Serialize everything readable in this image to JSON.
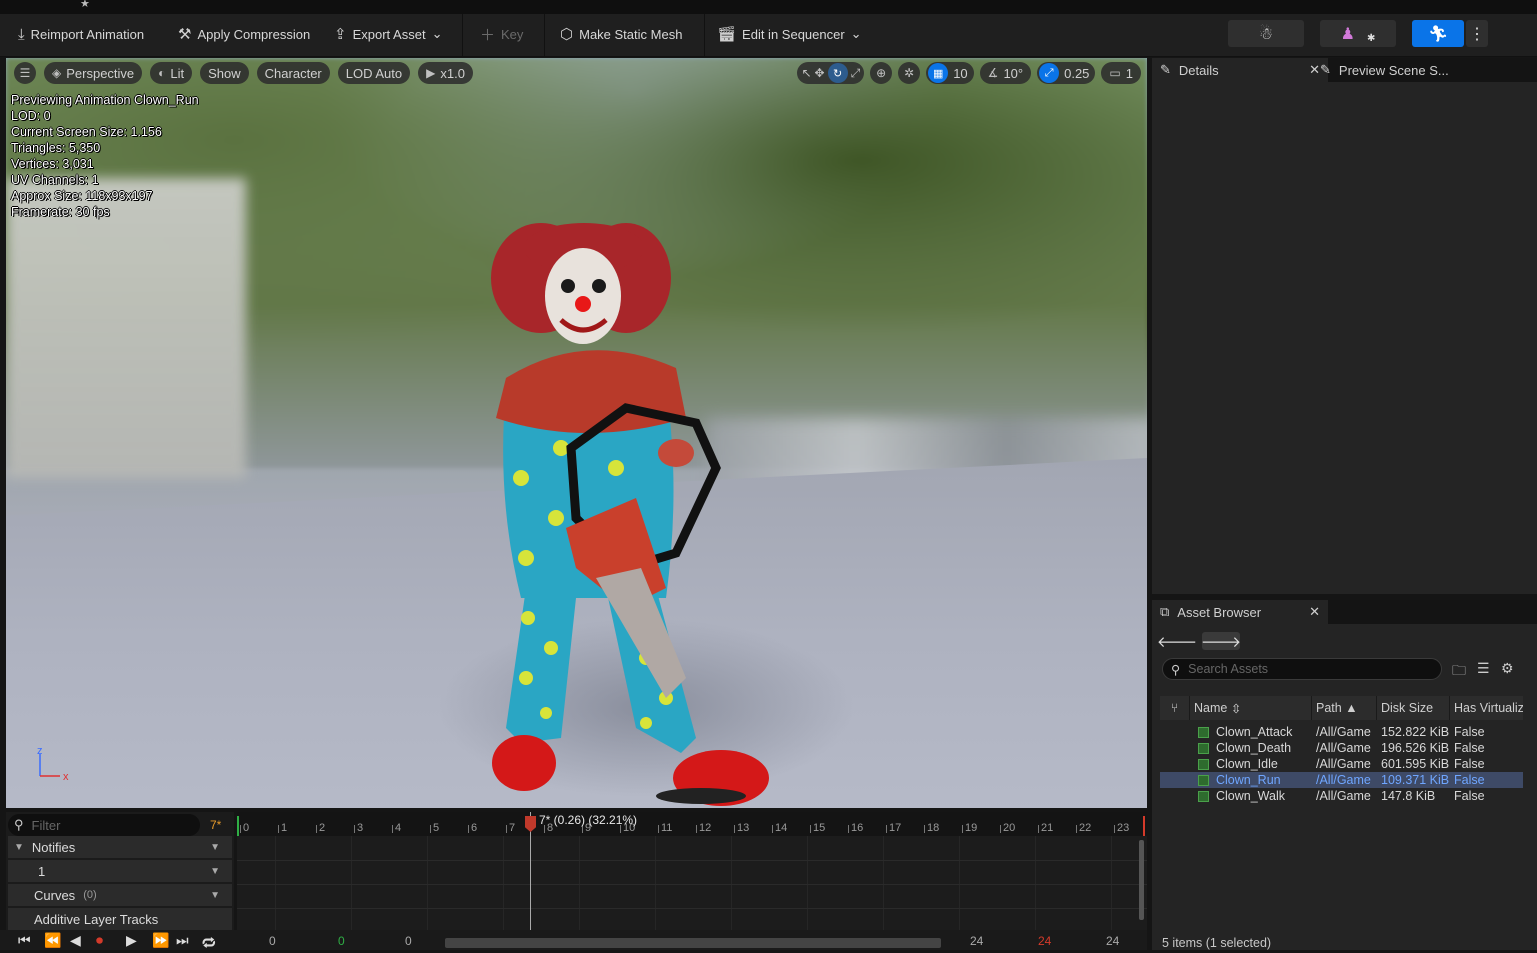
{
  "toolbar": {
    "reimport": "Reimport Animation",
    "compression": "Apply Compression",
    "export": "Export Asset",
    "key": "Key",
    "static_mesh": "Make Static Mesh",
    "sequencer": "Edit in Sequencer"
  },
  "viewport": {
    "perspective": "Perspective",
    "lit": "Lit",
    "show": "Show",
    "character": "Character",
    "lod": "LOD Auto",
    "play_rate": "x1.0",
    "grid_snap": "10",
    "rot_snap": "10°",
    "scale_snap": "0.25",
    "camera_speed": "1",
    "stats": [
      "Previewing Animation Clown_Run",
      "LOD: 0",
      "Current Screen Size: 1.156",
      "Triangles: 5,350",
      "Vertices: 3,031",
      "UV Channels: 1",
      "Approx Size: 118x93x197",
      "Framerate: 30 fps"
    ],
    "axis_z": "z",
    "axis_x": "x"
  },
  "details": {
    "tab1": "Details",
    "tab2": "Preview Scene S..."
  },
  "asset_browser": {
    "tab": "Asset Browser",
    "search_placeholder": "Search Assets",
    "columns": [
      "Name",
      "Path",
      "Disk Size",
      "Has Virtualiz"
    ],
    "rows": [
      {
        "name": "Clown_Attack",
        "path": "/All/Game",
        "size": "152.822 KiB",
        "virt": "False"
      },
      {
        "name": "Clown_Death",
        "path": "/All/Game",
        "size": "196.526 KiB",
        "virt": "False"
      },
      {
        "name": "Clown_Idle",
        "path": "/All/Game",
        "size": "601.595 KiB",
        "virt": "False"
      },
      {
        "name": "Clown_Run",
        "path": "/All/Game",
        "size": "109.371 KiB",
        "virt": "False"
      },
      {
        "name": "Clown_Walk",
        "path": "/All/Game",
        "size": "147.8 KiB",
        "virt": "False"
      }
    ],
    "selected_row": 3,
    "status": "5 items (1 selected)"
  },
  "timeline": {
    "filter_placeholder": "Filter",
    "current_frame": "7*",
    "playhead_label": "7* (0.26) (32.21%)",
    "notifies": "Notifies",
    "notify_track": "1",
    "curves": "Curves",
    "curves_count": "(0)",
    "additive": "Additive Layer Tracks",
    "ticks": [
      "0",
      "1",
      "2",
      "3",
      "4",
      "5",
      "6",
      "7",
      "8",
      "9",
      "10",
      "11",
      "12",
      "13",
      "14",
      "15",
      "16",
      "17",
      "18",
      "19",
      "20",
      "21",
      "22",
      "23"
    ],
    "range_start": "0",
    "range_start_green": "0",
    "range_start2": "0",
    "range_end": "24",
    "range_end_red": "24",
    "range_end2": "24"
  }
}
